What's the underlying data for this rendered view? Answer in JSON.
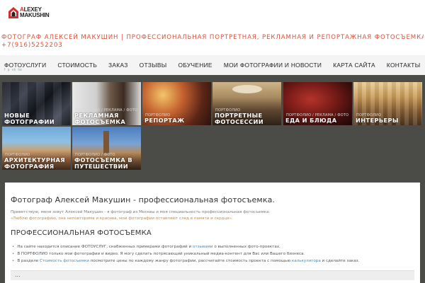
{
  "logo": {
    "line1_red": "A",
    "line1_rest": "LEXEY",
    "line2": "MAKUSHIN"
  },
  "header": {
    "tagline_line1": "ФОТОГРАФ АЛЕКСЕЙ МАКУШИН | ПРОФЕССИОНАЛЬНАЯ ПОРТРЕТНАЯ, РЕКЛАМНАЯ И РЕПОРТАЖНАЯ ФОТОСЪЕМКА В МОСКВЕ |",
    "tagline_line2": "+7(916)5252203"
  },
  "nav": {
    "items": [
      "ФОТОУСЛУГИ",
      "СТОИМОСТЬ",
      "ЗАКАЗ",
      "ОТЗЫВЫ",
      "ОБУЧЕНИЕ",
      "МОИ ФОТОГРАФИИ И НОВОСТИ",
      "КАРТА САЙТА",
      "КОНТАКТЫ"
    ],
    "social": [
      "f",
      "p",
      "vk",
      "tw"
    ]
  },
  "gallery": {
    "tiles": [
      {
        "cat": "",
        "title1": "НОВЫЕ",
        "title2": "ФОТОГРАФИИ"
      },
      {
        "cat": "ПОРТФОЛИО / РЕКЛАМА / ФОТО",
        "title1": "РЕКЛАМНАЯ",
        "title2": "ФОТОСЪЕМКА"
      },
      {
        "cat": "ПОРТФОЛИО",
        "title1": "РЕПОРТАЖ",
        "title2": ""
      },
      {
        "cat": "ПОРТФОЛИО",
        "title1": "ПОРТРЕТНЫЕ",
        "title2": "ФОТОСЕССИИ"
      },
      {
        "cat": "ПОРТФОЛИО / РЕКЛАМА / ФОТО",
        "title1": "ЕДА И БЛЮДА",
        "title2": ""
      },
      {
        "cat": "ПОРТФОЛИО",
        "title1": "ИНТЕРЬЕРЫ",
        "title2": ""
      },
      {
        "cat": "ПОРТФОЛИО",
        "title1": "АРХИТЕКТУРНАЯ",
        "title2": "ФОТОГРАФИЯ"
      },
      {
        "cat": "ПОРТФОЛИО / ФОТО",
        "title1": "ФОТОСЪЕМКА В",
        "title2": "ПУТЕШЕСТВИИ"
      }
    ]
  },
  "content": {
    "h1": "Фотограф Алексей Макушин - профессиональная фотосъемка.",
    "intro1": "Приветствую, меня зовут Алексей Макушин - я фотограф из Москвы и моя специальность профессиональная фотосъемка:",
    "intro2": "«Люблю фотографию, она неповторима и красива, мои фотографии оставляют след в памяти и сердце».",
    "h2": "ПРОФЕССИОНАЛЬНАЯ ФОТОСЪЕМКА",
    "b1a": "На сайте находится описание ФОТОУСЛУГ, снабженных примерами фотографий и ",
    "b1link": "отзывами",
    "b1b": " о выполненных фото-проектах.",
    "b2": "В ПОРТФОЛИО только мои фотографии и видео. Я могу сделать потрясающий уникальный медиа-контент для Вас или Вашего бизнеса.",
    "b3a": "В разделе ",
    "b3link1": "Стоимость фотосъемки",
    "b3b": " посмотрите цены по каждому жанру фотографии, рассчитайте стоимость проекта с помощью ",
    "b3link2": "калькулятора",
    "b3c": " и сделайте заказ.",
    "more": "..."
  },
  "colors": {
    "accent": "#d9533b",
    "nav_bg": "#f4f4f4",
    "gallery_bg": "#4b4b48",
    "link": "#3b8ec7"
  }
}
